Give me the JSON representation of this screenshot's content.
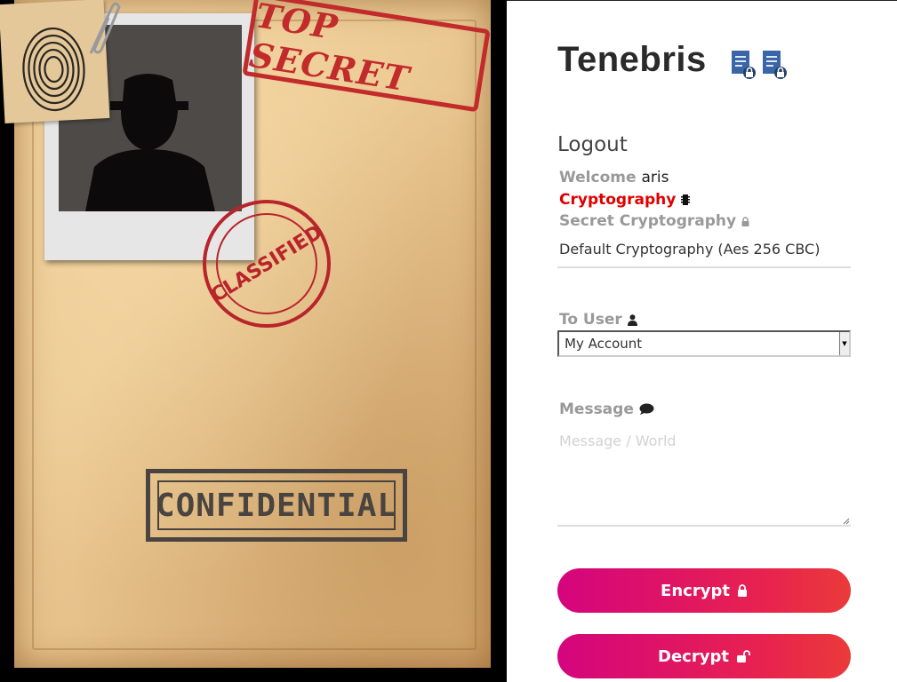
{
  "app": {
    "title": "Tenebris"
  },
  "images": {
    "stamp_top_secret": "TOP SECRET",
    "stamp_confidential": "CONFIDENTIAL",
    "stamp_classified": "CLASSIFIED"
  },
  "header": {
    "logout_label": "Logout"
  },
  "user": {
    "welcome_label": "Welcome",
    "username": "aris"
  },
  "crypto": {
    "label": "Cryptography",
    "secret_label": "Secret Cryptography",
    "default_value": "Default Cryptography (Aes 256 CBC)"
  },
  "to_user": {
    "label": "To User",
    "selected": "My Account"
  },
  "message": {
    "label": "Message",
    "placeholder": "Message / World"
  },
  "buttons": {
    "encrypt_label": "Encrypt",
    "decrypt_label": "Decrypt"
  },
  "colors": {
    "accent": "#e00000",
    "button_start": "#d4047e",
    "button_end": "#ea3a3a",
    "label_gray": "#999999"
  },
  "icons": [
    "document-lock-icon",
    "microchip-icon",
    "lock-icon",
    "user-icon",
    "comment-icon",
    "unlock-icon"
  ]
}
